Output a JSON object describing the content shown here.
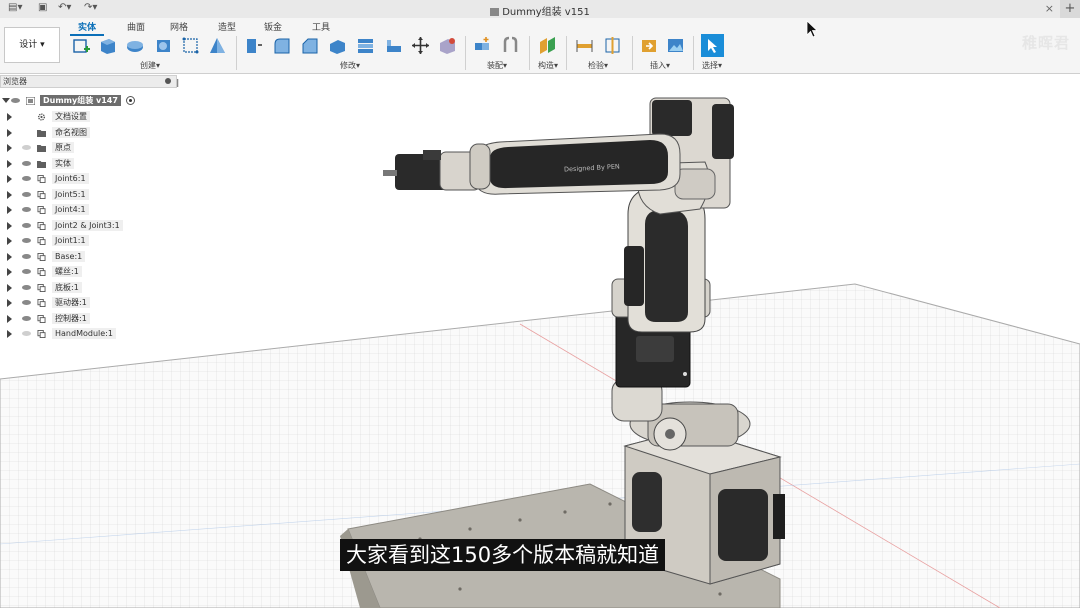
{
  "window": {
    "title": "Dummy组装 v151",
    "quick_access": [
      "▤▾",
      "▣",
      "↶▾",
      "↷▾"
    ]
  },
  "ribbon": {
    "workspace": "设计 ▾",
    "tabs": [
      {
        "label": "实体",
        "active": true
      },
      {
        "label": "曲面",
        "active": false
      },
      {
        "label": "网格",
        "active": false
      },
      {
        "label": "造型",
        "active": false
      },
      {
        "label": "钣金",
        "active": false
      },
      {
        "label": "工具",
        "active": false
      }
    ],
    "groups": [
      "创建▾",
      "修改▾",
      "装配▾",
      "构造▾",
      "检验▾",
      "插入▾",
      "选择▾"
    ],
    "brand": "稚晖君",
    "accent": "#0a6fb8"
  },
  "browser": {
    "title": "浏览器",
    "root": "Dummy组装 v147",
    "items": [
      {
        "label": "文档设置",
        "icon": "gear-icon",
        "eye": false
      },
      {
        "label": "命名视图",
        "icon": "folder-icon",
        "eye": false
      },
      {
        "label": "原点",
        "icon": "folder-icon",
        "eye": "dim"
      },
      {
        "label": "实体",
        "icon": "folder-icon",
        "eye": true
      },
      {
        "label": "Joint6:1",
        "icon": "component-icon",
        "eye": true
      },
      {
        "label": "Joint5:1",
        "icon": "component-icon",
        "eye": true
      },
      {
        "label": "Joint4:1",
        "icon": "component-icon",
        "eye": true
      },
      {
        "label": "Joint2 & Joint3:1",
        "icon": "component-icon",
        "eye": true
      },
      {
        "label": "Joint1:1",
        "icon": "component-icon",
        "eye": true
      },
      {
        "label": "Base:1",
        "icon": "component-icon",
        "eye": true
      },
      {
        "label": "螺丝:1",
        "icon": "component-icon",
        "eye": true
      },
      {
        "label": "底板:1",
        "icon": "component-icon",
        "eye": true
      },
      {
        "label": "驱动器:1",
        "icon": "component-icon",
        "eye": true
      },
      {
        "label": "控制器:1",
        "icon": "component-icon",
        "eye": true
      },
      {
        "label": "HandModule:1",
        "icon": "component-icon",
        "eye": "dim"
      }
    ]
  },
  "viewport": {
    "arm_label": "Designed By PEN"
  },
  "subtitle": "大家看到这150多个版本稿就知道"
}
